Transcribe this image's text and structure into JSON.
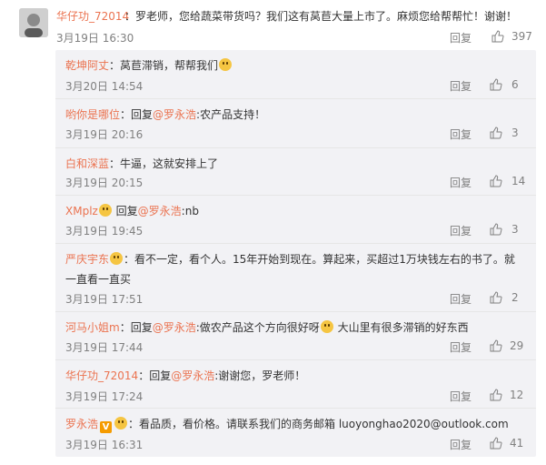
{
  "main_comment": {
    "author": "华仔功_72014",
    "text": "：罗老师，您给蔬菜带货吗？我们这有莴苣大量上市了。麻烦您给帮帮忙！谢谢！",
    "date": "3月19日 16:30",
    "reply_label": "回复",
    "likes": "397"
  },
  "replies": [
    {
      "author": "乾坤阿丈",
      "pre": "：莴苣滞销，帮帮我们",
      "at": "",
      "post": "",
      "emoji": true,
      "date": "3月20日 14:54",
      "reply_label": "回复",
      "likes": "6"
    },
    {
      "author": "哟你是哪位",
      "pre": "：回复",
      "at": "@罗永浩",
      "post": ":农产品支持！",
      "emoji": false,
      "date": "3月19日 20:16",
      "reply_label": "回复",
      "likes": "3"
    },
    {
      "author": "白和深蓝",
      "pre": "：牛逼，这就安排上了",
      "at": "",
      "post": "",
      "emoji": false,
      "date": "3月19日 20:15",
      "reply_label": "回复",
      "likes": "14"
    },
    {
      "author": "XMplz",
      "pre": " 回复",
      "at": "@罗永浩",
      "post": ":nb",
      "emoji": false,
      "badge_emoji": true,
      "date": "3月19日 19:45",
      "reply_label": "回复",
      "likes": "3"
    },
    {
      "author": "严庆宇东",
      "line1": "：看不一定，看个人。15年开始到现在。算起来，买超过1万块钱左右的书了。就",
      "line2": "一直看一直买",
      "date": "3月19日 17:51",
      "reply_label": "回复",
      "likes": "2"
    },
    {
      "author": "河马小姐m",
      "pre": "：回复",
      "at": "@罗永浩",
      "post": ":做农产品这个方向很好呀",
      "post2": " 大山里有很多滞销的好东西",
      "emoji": true,
      "date": "3月19日 17:44",
      "reply_label": "回复",
      "likes": "29"
    },
    {
      "author": "华仔功_72014",
      "pre": "：回复",
      "at": "@罗永浩",
      "post": ":谢谢您，罗老师！",
      "emoji": false,
      "date": "3月19日 17:24",
      "reply_label": "回复",
      "likes": "12"
    },
    {
      "author": "罗永浩",
      "pre": "：看品质，看价格。请联系我们的商务邮箱 luoyonghao2020@outlook.com",
      "at": "",
      "post": "",
      "emoji": false,
      "verified": true,
      "date": "3月19日 16:31",
      "reply_label": "回复",
      "likes": "41"
    }
  ]
}
